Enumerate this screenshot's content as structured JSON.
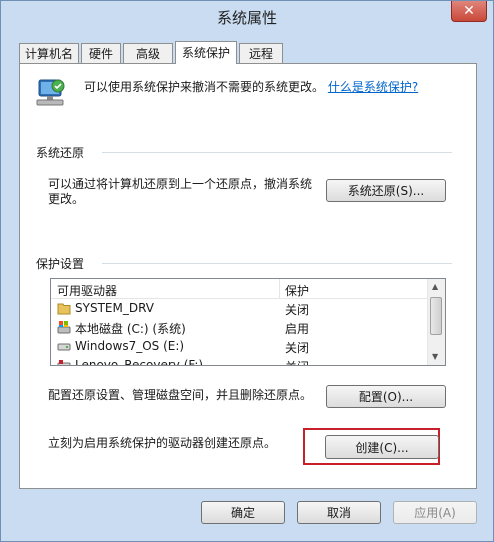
{
  "window": {
    "title": "系统属性",
    "close_glyph": "✕"
  },
  "tabs": [
    {
      "label": "计算机名"
    },
    {
      "label": "硬件"
    },
    {
      "label": "高级"
    },
    {
      "label": "系统保护",
      "active": true
    },
    {
      "label": "远程"
    }
  ],
  "intro": {
    "text": "可以使用系统保护来撤消不需要的系统更改。",
    "link": "什么是系统保护?"
  },
  "restore": {
    "heading": "系统还原",
    "desc_line1": "可以通过将计算机还原到上一个还原点，撤消系统",
    "desc_line2": "更改。",
    "button": "系统还原(S)..."
  },
  "protection": {
    "heading": "保护设置",
    "columns": [
      "可用驱动器",
      "保护"
    ],
    "drives": [
      {
        "name": "SYSTEM_DRV",
        "state": "关闭",
        "icon": "folder-icon"
      },
      {
        "name": "本地磁盘 (C:) (系统)",
        "state": "启用",
        "icon": "system-drive-icon"
      },
      {
        "name": "Windows7_OS (E:)",
        "state": "关闭",
        "icon": "drive-icon"
      },
      {
        "name": "Lenovo_Recovery (F:)",
        "state": "关闭",
        "icon": "drive-icon"
      }
    ],
    "configure_desc": "配置还原设置、管理磁盘空间，并且删除还原点。",
    "configure_button": "配置(O)...",
    "create_desc": "立刻为启用系统保护的驱动器创建还原点。",
    "create_button": "创建(C)..."
  },
  "footer": {
    "ok": "确定",
    "cancel": "取消",
    "apply": "应用(A)"
  },
  "colors": {
    "frame": "#c9dcf1",
    "link": "#0066cc",
    "highlight": "#c8202a"
  }
}
